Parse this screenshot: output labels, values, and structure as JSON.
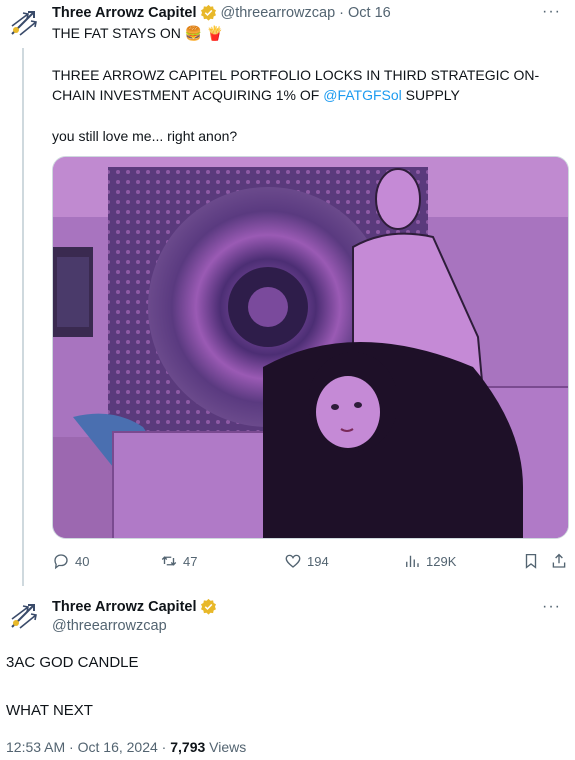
{
  "tweet1": {
    "author_name": "Three Arrowz Capitel",
    "handle": "@threearrowzcap",
    "separator": "·",
    "date": "Oct 16",
    "line1": "THE FAT STAYS ON",
    "line1_emoji": "🍔 🍟",
    "line2": "THREE ARROWZ CAPITEL PORTFOLIO LOCKS IN THIRD STRATEGIC ON-",
    "line3_prefix": "CHAIN INVESTMENT ACQUIRING 1% OF",
    "line3_link": "@FATGFSol",
    "line3_suffix": "SUPPLY",
    "line4": "you still love me... right anon?",
    "actions": {
      "replies": "40",
      "retweets": "47",
      "likes": "194",
      "views": "129K"
    },
    "more_icon": "more-dots-icon"
  },
  "tweet2": {
    "author_name": "Three Arrowz Capitel",
    "handle": "@threearrowzcap",
    "body1": "3AC GOD CANDLE",
    "body2": "WHAT NEXT",
    "time": "12:53 AM",
    "separator": "·",
    "date": "Oct 16, 2024",
    "views_count": "7,793",
    "views_label": "Views"
  },
  "colors": {
    "link": "#1d9bf0",
    "muted": "#536471",
    "badge": "#e8b829",
    "media_tint": "#b07ac7"
  }
}
